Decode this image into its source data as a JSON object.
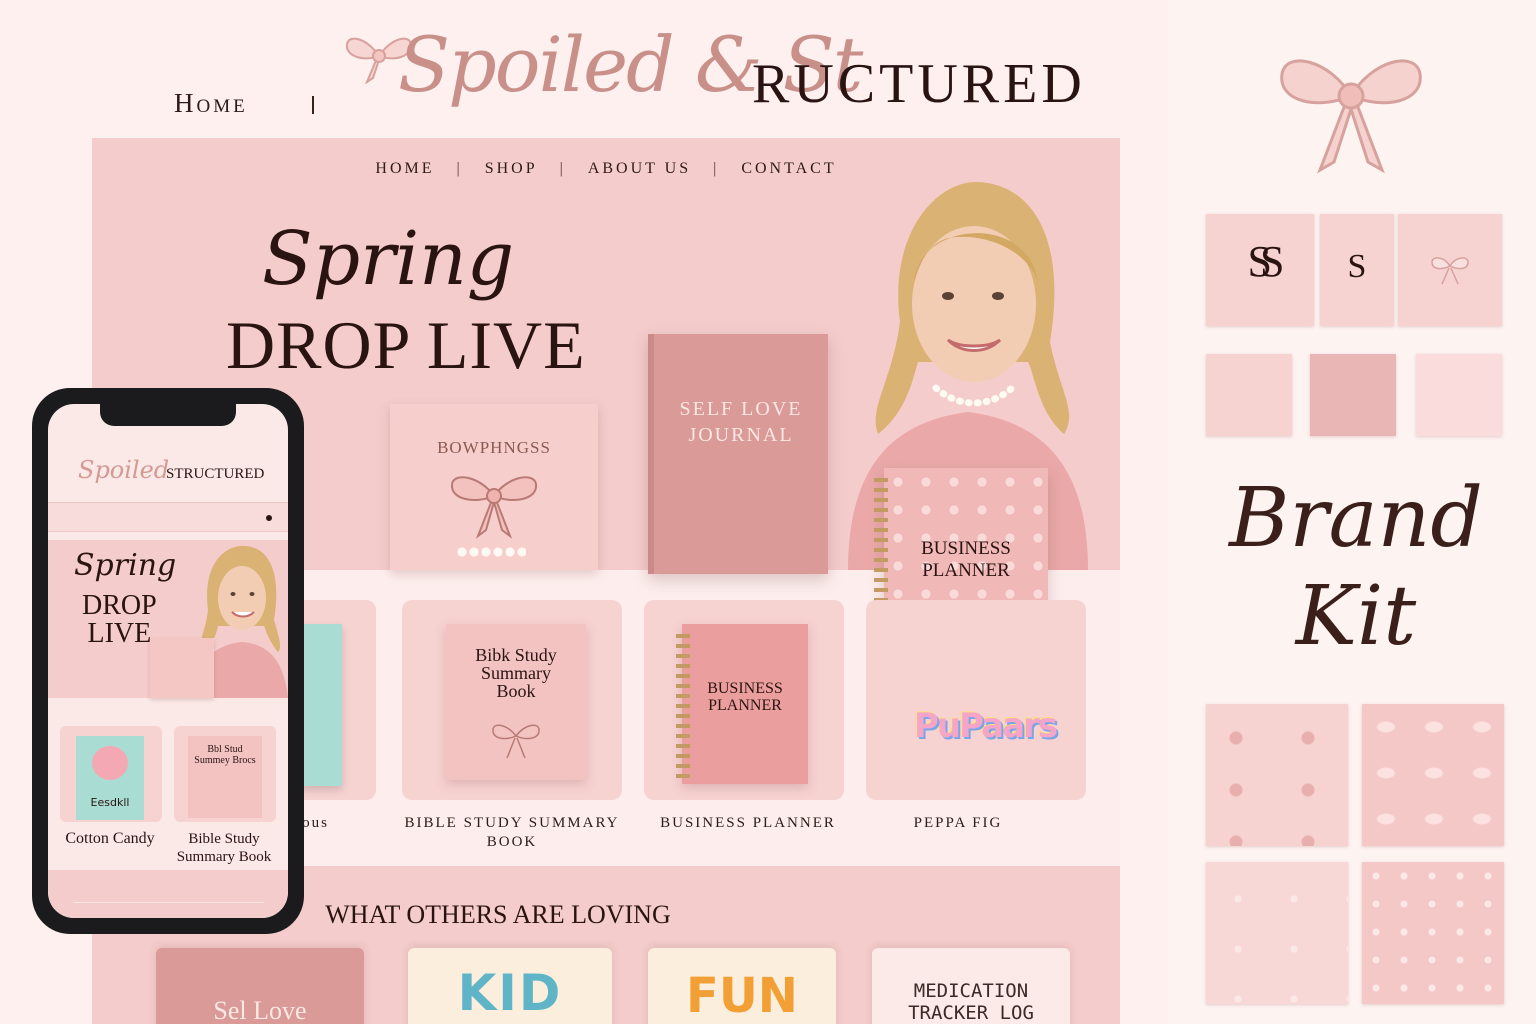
{
  "header": {
    "home_label": "Home",
    "logo_script": "Spoiled & St",
    "logo_caps": "RUCTURED"
  },
  "site": {
    "nav": [
      "HOME",
      "SHOP",
      "ABOUT US",
      "CONTACT"
    ],
    "hero": {
      "script": "Spring",
      "title": "DROP LIVE"
    },
    "hero_books": {
      "bow": "BOWPHNGSS",
      "self_love": "SELF LOVE JOURNAL",
      "planner": "BUSINESS PLANNER"
    },
    "products": [
      {
        "title": "rous",
        "book": ""
      },
      {
        "title": "BIBLE STUDY SUMMARY BOOK",
        "book": "Bibk Study Summary Book"
      },
      {
        "title": "BUSINESS PLANNER",
        "book": "BUSINESS PLANNER"
      },
      {
        "title": "PEPPA FIG",
        "book": "PuPaars"
      }
    ],
    "loving_title": "WHAT OTHERS ARE LOVING",
    "loving": [
      {
        "label": "Sel Love"
      },
      {
        "label": "KID"
      },
      {
        "label": "FUN"
      },
      {
        "label": "MEDICATION TRACKER LOG"
      }
    ]
  },
  "phone": {
    "logo_script": "Spoiled",
    "logo_caps": "STRUCTURED",
    "hero_script": "Spring",
    "hero_title_1": "DROP",
    "hero_title_2": "LIVE",
    "products": [
      {
        "label": "Cotton Candy",
        "book": "Eesdkll"
      },
      {
        "label": "Bible Study Summary Book",
        "book": "Bbl Stud Summey Brocs"
      }
    ]
  },
  "brand_kit": {
    "title_1": "Brand",
    "title_2": "Kit",
    "monogram_1": "SS",
    "monogram_2": "S",
    "colors": [
      "#f6d2d1",
      "#eab6b5",
      "#f9dcdb"
    ]
  },
  "palette": {
    "background": "#fdf0ee",
    "site_pink": "#f4cccb",
    "dusty_rose": "#d99a98",
    "ink": "#2a1411"
  }
}
